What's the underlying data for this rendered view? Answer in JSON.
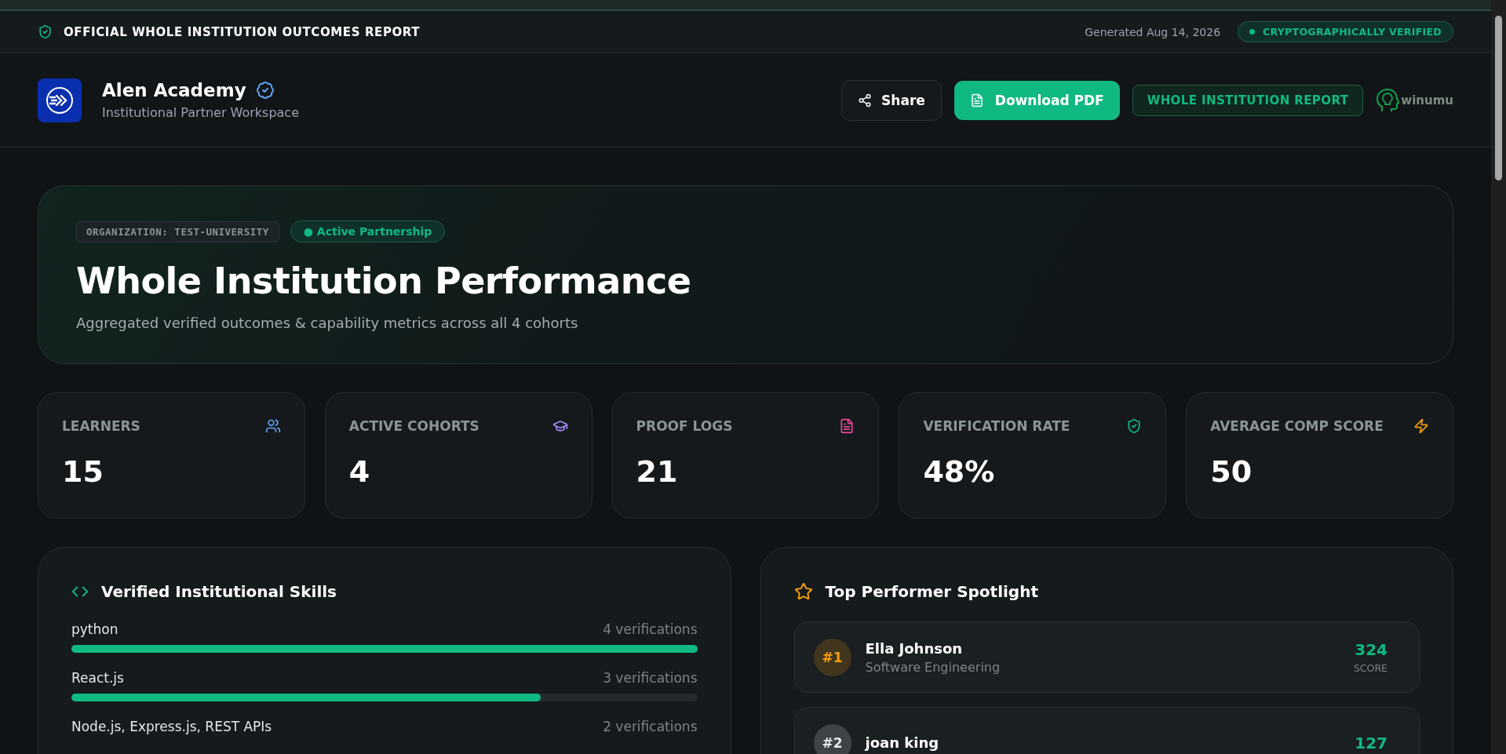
{
  "banner": {
    "title": "OFFICIAL WHOLE INSTITUTION OUTCOMES REPORT",
    "generated": "Generated Aug 14, 2026",
    "verified_badge": "CRYPTOGRAPHICALLY VERIFIED"
  },
  "header": {
    "org_name": "Alen Academy",
    "org_subtitle": "Institutional Partner Workspace",
    "share_button": "Share",
    "download_button": "Download PDF",
    "report_badge": "WHOLE INSTITUTION REPORT",
    "brand": "winumu"
  },
  "hero": {
    "org_tag": "ORGANIZATION: TEST-UNIVERSITY",
    "status_tag": "● Active Partnership",
    "title": "Whole Institution Performance",
    "subtitle": "Aggregated verified outcomes & capability metrics across all 4 cohorts"
  },
  "stats": [
    {
      "label": "LEARNERS",
      "value": "15",
      "color": "#60a5fa"
    },
    {
      "label": "ACTIVE COHORTS",
      "value": "4",
      "color": "#a78bfa"
    },
    {
      "label": "PROOF LOGS",
      "value": "21",
      "color": "#ec4899"
    },
    {
      "label": "VERIFICATION RATE",
      "value": "48%",
      "color": "#10b981"
    },
    {
      "label": "AVERAGE COMP SCORE",
      "value": "50",
      "color": "#f59e0b"
    }
  ],
  "skills": {
    "title": "Verified Institutional Skills",
    "items": [
      {
        "name": "python",
        "count": "4 verifications",
        "level": 1
      },
      {
        "name": "React.js",
        "count": "3 verifications",
        "level": 0.75
      },
      {
        "name": "Node.js, Express.js, REST APIs",
        "count": "2 verifications"
      }
    ]
  },
  "performers": {
    "title": "Top Performer Spotlight",
    "items": [
      {
        "rank": "#1",
        "color": "#f59e0b",
        "name": "Ella Johnson",
        "department": "Software Engineering",
        "score": "324",
        "score_label": "SCORE"
      },
      {
        "rank": "#2",
        "color": "#e5e7eb",
        "name": "joan king",
        "score": "127"
      }
    ]
  }
}
